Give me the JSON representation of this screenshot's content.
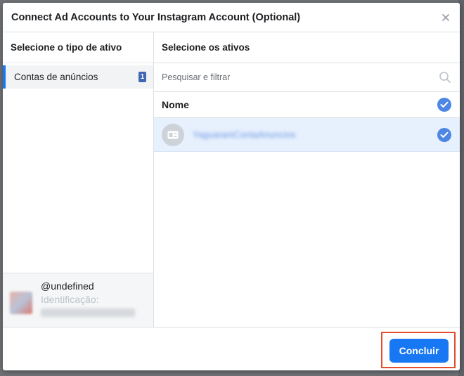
{
  "modal": {
    "title": "Connect Ad Accounts to Your Instagram Account (Optional)",
    "close_icon": "close-icon"
  },
  "left": {
    "title": "Selecione o tipo de ativo",
    "asset_types": [
      {
        "label": "Contas de anúncios",
        "count": "1"
      }
    ],
    "account": {
      "handle": "@undefined",
      "id_label": "Identificação:",
      "id_value": "17841401234567890"
    }
  },
  "right": {
    "title": "Selecione os ativos",
    "search": {
      "placeholder": "Pesquisar e filtrar"
    },
    "column_header": "Nome",
    "assets": [
      {
        "name": "YaguaraniContaAnuncios",
        "selected": true,
        "icon": "ad-account-icon"
      }
    ]
  },
  "footer": {
    "done_label": "Concluir"
  },
  "colors": {
    "accent": "#1877f2",
    "check": "#4e86e4",
    "selected_row": "#e7f0fd",
    "highlight_frame": "#e04e2a"
  }
}
